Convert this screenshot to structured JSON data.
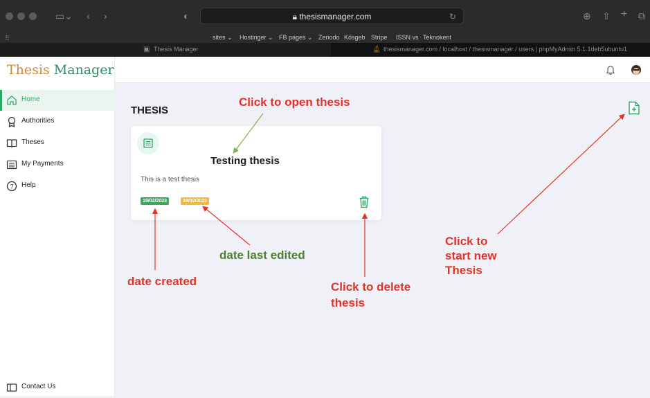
{
  "browser": {
    "url": "thesismanager.com",
    "bookmarks": [
      "sites ⌄",
      "Hostinger ⌄",
      "FB pages ⌄",
      "Zenodo",
      "Kösgeb",
      "Stripe",
      "ISSN vs",
      "Teknokent"
    ],
    "tabs": [
      {
        "title": "Thesis Manager"
      },
      {
        "title": "thesismanager.com / localhost / thesismanager / users | phpMyAdmin 5.1.1deb5ubuntu1"
      }
    ]
  },
  "app": {
    "logo_part1": "Thesis ",
    "logo_part2": "Manager",
    "nav": [
      {
        "label": "Home",
        "icon": "home-icon",
        "active": true
      },
      {
        "label": "Authorities",
        "icon": "award-icon",
        "active": false
      },
      {
        "label": "Theses",
        "icon": "book-icon",
        "active": false
      },
      {
        "label": "My Payments",
        "icon": "receipt-icon",
        "active": false
      },
      {
        "label": "Help",
        "icon": "help-circle-icon",
        "active": false
      }
    ],
    "contact_label": "Contact Us",
    "page_title": "THESIS",
    "card": {
      "title": "Testing thesis",
      "description": "This is a test thesis",
      "created": "19/02/2023",
      "edited": "19/02/2023"
    },
    "colors": {
      "accent": "#2ea86a",
      "created_badge": "#3aa85e",
      "edited_badge": "#f2b93b",
      "delete": "#2ea86a"
    }
  },
  "annotations": {
    "open": "Click to open thesis",
    "last_edited": "date last edited",
    "created": "date created",
    "delete_line1": "Click to delete",
    "delete_line2": "thesis",
    "new_line1": "Click to",
    "new_line2": "start new",
    "new_line3": "Thesis"
  }
}
